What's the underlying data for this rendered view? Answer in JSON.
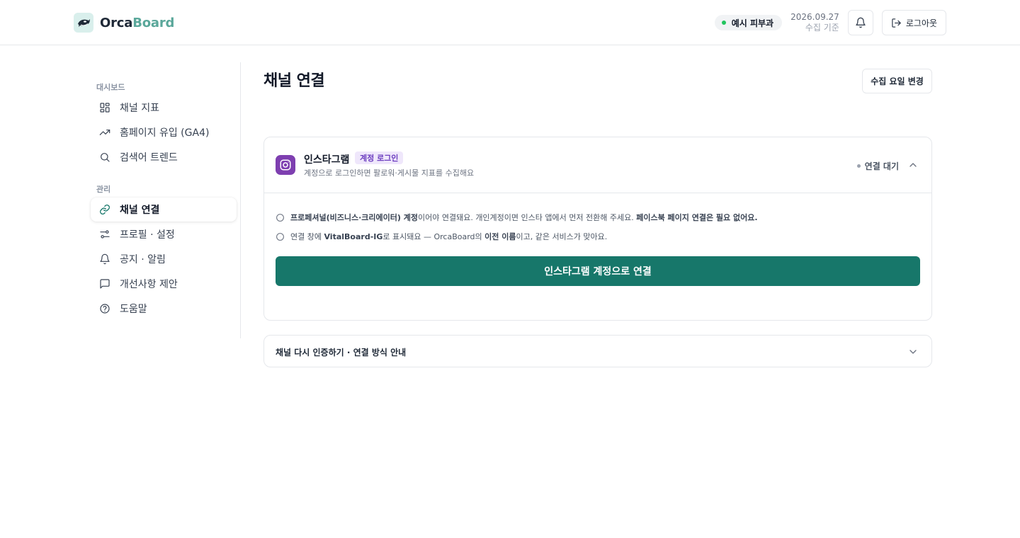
{
  "brand": {
    "part1": "Orca",
    "part2": "Board",
    "accent": "#5aa79a"
  },
  "header": {
    "clinic": "예시 피부과",
    "date": "2026.09.27",
    "date_caption": "수집 기준",
    "logout_label": "로그아웃"
  },
  "sidebar": {
    "section1": "대시보드",
    "section2": "관리",
    "items": [
      {
        "label": "채널 지표",
        "icon": "grid-icon"
      },
      {
        "label": "홈페이지 유입 (GA4)",
        "icon": "trending-up-icon"
      },
      {
        "label": "검색어 트렌드",
        "icon": "search-icon"
      },
      {
        "label": "채널 연결",
        "icon": "link-icon",
        "active": true
      },
      {
        "label": "프로필 · 설정",
        "icon": "sliders-icon"
      },
      {
        "label": "공지 · 알림",
        "icon": "bell-icon"
      },
      {
        "label": "개선사항 제안",
        "icon": "message-icon"
      },
      {
        "label": "도움말",
        "icon": "help-icon"
      }
    ]
  },
  "main": {
    "title": "채널 연결",
    "change_button": "수집 요일 변경",
    "channel": {
      "name": "인스타그램",
      "tag": "계정 로그인",
      "desc": "계정으로 로그인하면 팔로워·게시물 지표를 수집해요",
      "status": "연결 대기",
      "note1": {
        "b1": "프로페셔널(비즈니스·크리에이터) 계정",
        "t1": "이어야 연결돼요. 개인계정이면 인스타 앱에서 먼저 전환해 주세요. ",
        "b2": "페이스북 페이지 연결은 필요 없어요."
      },
      "note2": {
        "t1": "연결 창에 ",
        "b1": "VitalBoard-IG",
        "t2": "로 표시돼요 — OrcaBoard의 ",
        "b2": "이전 이름",
        "t3": "이고, 같은 서비스가 맞아요."
      },
      "connect_button": "인스타그램 계정으로 연결"
    },
    "accordion_title": "채널 다시 인증하기 · 연결 방식 안내"
  },
  "colors": {
    "primary": "#17776a",
    "instagram": "#7e3fb0",
    "status_dot": "#22c55e"
  }
}
